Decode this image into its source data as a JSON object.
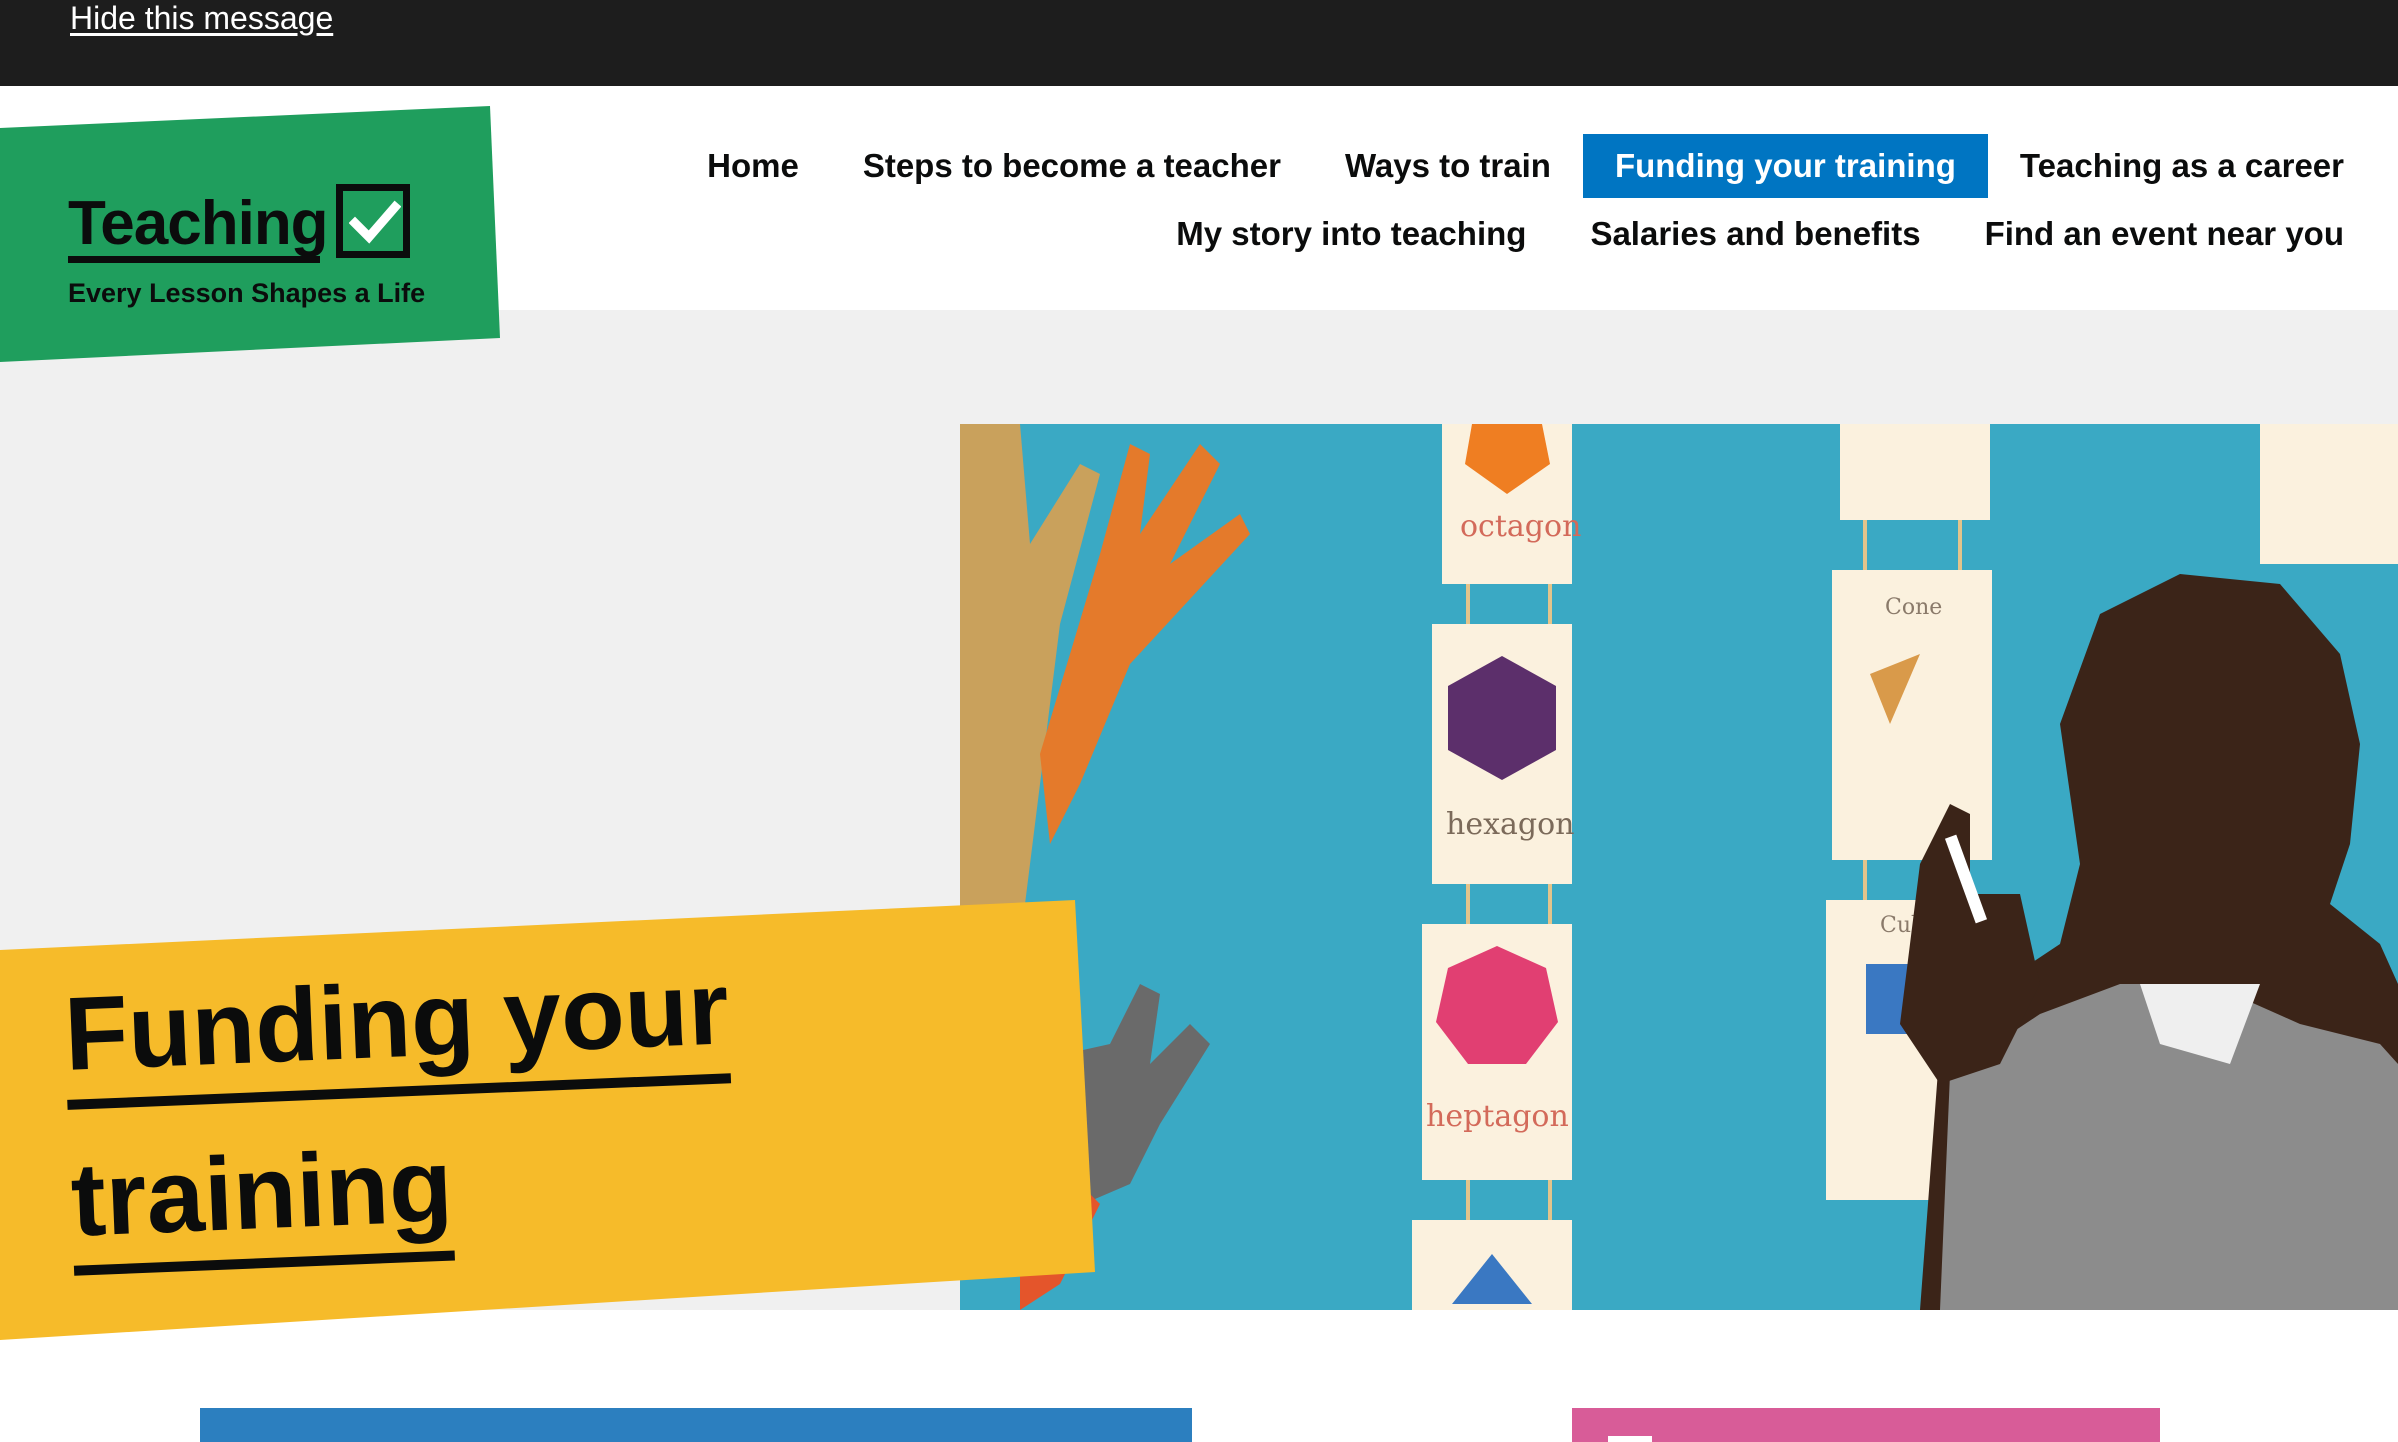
{
  "cookie_bar": {
    "hide_link": "Hide this message"
  },
  "logo": {
    "word": "Teaching",
    "tagline": "Every Lesson Shapes a Life"
  },
  "nav": {
    "row1": [
      {
        "label": "Home",
        "active": false
      },
      {
        "label": "Steps to become a teacher",
        "active": false
      },
      {
        "label": "Ways to train",
        "active": false
      },
      {
        "label": "Funding your training",
        "active": true
      },
      {
        "label": "Teaching as a career",
        "active": false
      }
    ],
    "row2": [
      {
        "label": "My story into teaching",
        "active": false
      },
      {
        "label": "Salaries and benefits",
        "active": false
      },
      {
        "label": "Find an event near you",
        "active": false
      }
    ]
  },
  "hero": {
    "title_line1": "Funding your",
    "title_line2": "training",
    "image_alt": "Teacher pointing in a classroom in front of shape posters",
    "poster_labels": [
      "octagon",
      "hexagon",
      "heptagon",
      "Cone",
      "Cube"
    ]
  },
  "colors": {
    "cookie_bg": "#1d1d1d",
    "brand_green": "#1f9e5d",
    "nav_active": "#0075c2",
    "hero_yellow": "#f6bb2a",
    "hero_bg": "#f0f0f0",
    "card_blue": "#2c7fbf",
    "card_pink": "#d85c98"
  }
}
